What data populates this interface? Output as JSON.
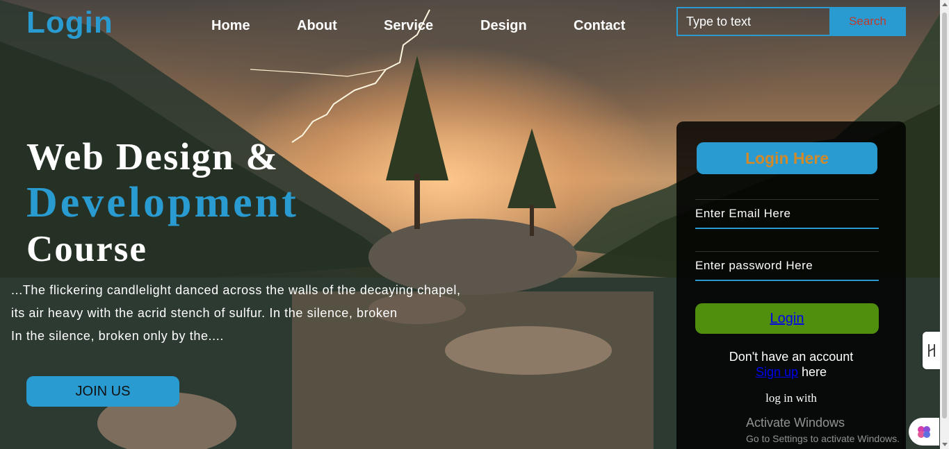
{
  "header": {
    "logo": "Login",
    "nav": [
      "Home",
      "About",
      "Service",
      "Design",
      "Contact"
    ],
    "search_placeholder": "Type to text",
    "search_label": "Search"
  },
  "hero": {
    "line1": "Web Design &",
    "line2": "Development",
    "line3": "Course",
    "paragraph": [
      "...The flickering candlelight danced across the walls of the decaying chapel,",
      "its air heavy with the acrid stench of sulfur. In the silence, broken",
      "In the silence, broken only by the...."
    ],
    "join_label": "JOIN US"
  },
  "login_card": {
    "title": "Login Here",
    "email_placeholder": "Enter Email Here",
    "password_placeholder": "Enter password Here",
    "login_label": "Login",
    "account_text": "Don't have an account",
    "signup_link": "Sign up",
    "signup_suffix": " here",
    "login_with": "log in with"
  },
  "watermark": {
    "title": "Activate Windows",
    "subtitle": "Go to Settings to activate Windows."
  },
  "colors": {
    "accent": "#2a9bd0",
    "login_button": "#4f8f0d",
    "card_title_text": "#d18a2a",
    "search_text": "#c0392b"
  },
  "icons": [
    "lightning-bolt",
    "side-tool-icon",
    "brain-icon"
  ]
}
